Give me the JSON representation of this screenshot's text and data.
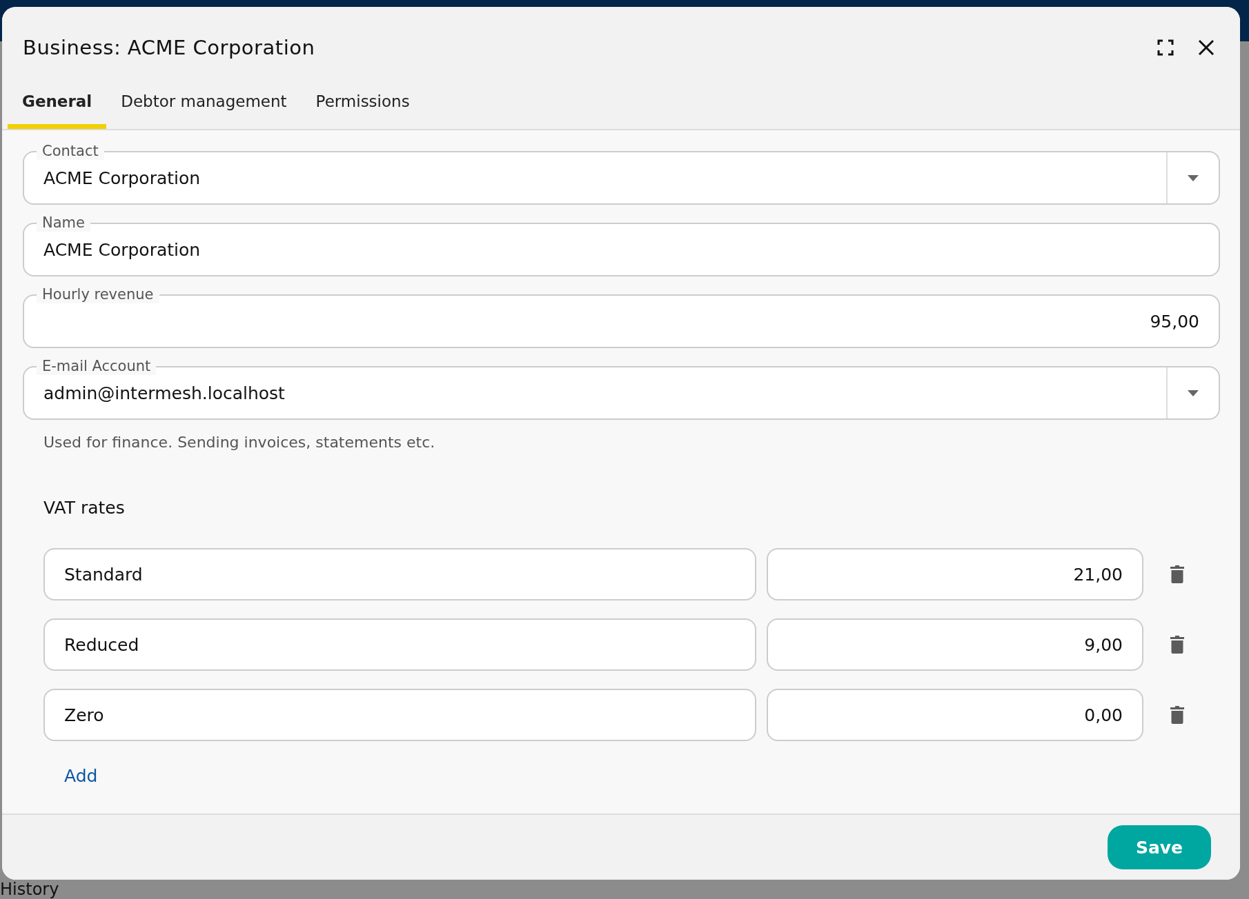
{
  "background": {
    "label": "History"
  },
  "dialog": {
    "title": "Business: ACME Corporation",
    "tabs": [
      {
        "label": "General",
        "selected": true
      },
      {
        "label": "Debtor management",
        "selected": false
      },
      {
        "label": "Permissions",
        "selected": false
      }
    ],
    "fields": [
      {
        "kind": "select",
        "label": "Contact",
        "value": "ACME Corporation"
      },
      {
        "kind": "text",
        "label": "Name",
        "value": "ACME Corporation"
      },
      {
        "kind": "number",
        "label": "Hourly revenue",
        "value": "95,00"
      },
      {
        "kind": "select",
        "label": "E-mail Account",
        "value": "admin@intermesh.localhost",
        "hint": "Used for finance. Sending invoices, statements etc."
      }
    ],
    "vat_rates": {
      "title": "VAT rates",
      "rows": [
        {
          "name": "Standard",
          "rate": "21,00"
        },
        {
          "name": "Reduced",
          "rate": "9,00"
        },
        {
          "name": "Zero",
          "rate": "0,00"
        }
      ],
      "add_link": "Add"
    },
    "save_button": "Save"
  }
}
